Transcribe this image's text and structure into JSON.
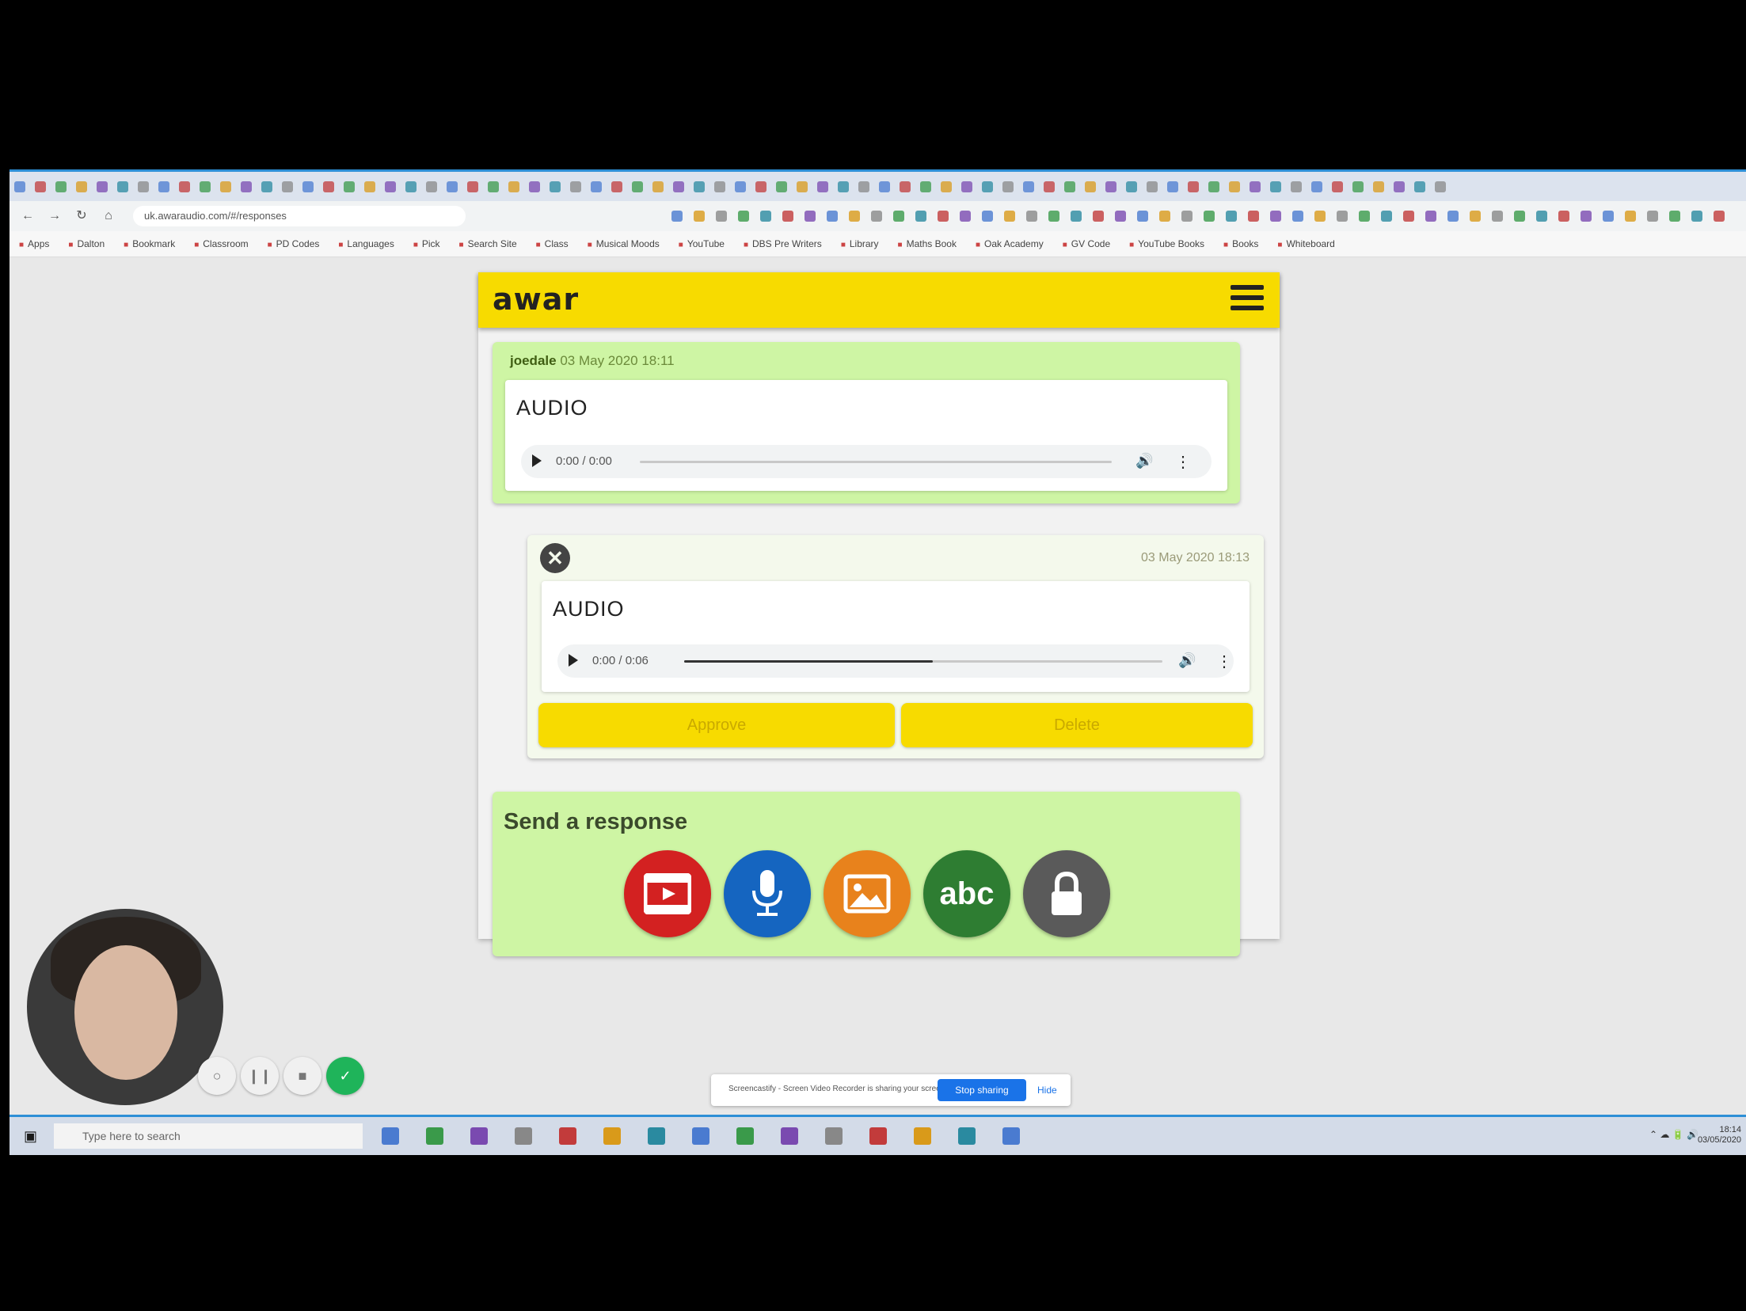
{
  "browser": {
    "url": "uk.awaraudio.com/#/responses",
    "bookmarks": [
      "Apps",
      "Dalton",
      "Bookmark",
      "Classroom",
      "PD Codes",
      "Languages",
      "Pick",
      "Search Site",
      "Class",
      "Musical Moods",
      "YouTube",
      "DBS Pre Writers",
      "Library",
      "Maths Book",
      "Oak Academy",
      "GV Code",
      "YouTube Books",
      "Books",
      "Whiteboard"
    ]
  },
  "app": {
    "logo": "awar",
    "message1": {
      "author": "joedale",
      "date": "03 May 2020 18:11",
      "label": "AUDIO",
      "time": "0:00 / 0:00"
    },
    "message2": {
      "date": "03 May 2020 18:13",
      "label": "AUDIO",
      "time": "0:00 / 0:06",
      "progress": 0.52,
      "approve_label": "Approve",
      "delete_label": "Delete"
    },
    "respond": {
      "title": "Send a response",
      "buttons": [
        {
          "name": "video",
          "color": "#d32121"
        },
        {
          "name": "audio",
          "color": "#1565c0"
        },
        {
          "name": "image",
          "color": "#e8821c"
        },
        {
          "name": "text",
          "color": "#2e7d32",
          "label": "abc"
        },
        {
          "name": "lock",
          "color": "#5a5a5a"
        }
      ]
    }
  },
  "screenshare": {
    "text": "Screencastify - Screen Video Recorder is sharing your screen",
    "stop_label": "Stop sharing",
    "hide_label": "Hide"
  },
  "taskbar": {
    "search_placeholder": "Type here to search",
    "clock_time": "18:14",
    "clock_date": "03/05/2020"
  }
}
